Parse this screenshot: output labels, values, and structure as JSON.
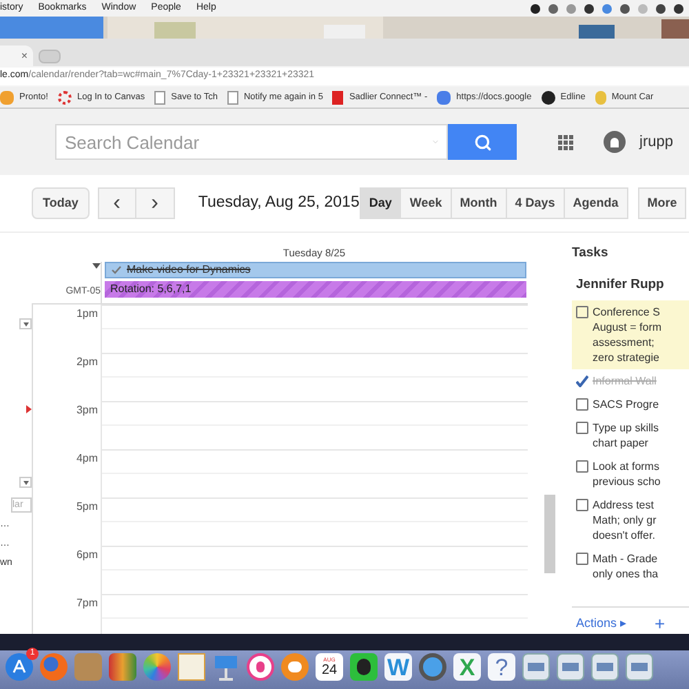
{
  "menu_bar": {
    "items": [
      "istory",
      "Bookmarks",
      "Window",
      "People",
      "Help"
    ]
  },
  "browser": {
    "tab_close": "×",
    "url_host": "le.com",
    "url_path": "/calendar/render?tab=wc#main_7%7Cday-1+23321+23321+23321",
    "bookmarks": [
      {
        "label": "Pronto!",
        "kind": "star"
      },
      {
        "label": "Log In to Canvas",
        "kind": "ring"
      },
      {
        "label": "Save to Tch",
        "kind": "page"
      },
      {
        "label": "Notify me again in 5",
        "kind": "page"
      },
      {
        "label": "Sadlier Connect™ -",
        "kind": "red"
      },
      {
        "label": "https://docs.google",
        "kind": "doc"
      },
      {
        "label": "Edline",
        "kind": "swirl"
      },
      {
        "label": "Mount Car",
        "kind": "gold"
      }
    ]
  },
  "header": {
    "search": {
      "placeholder": "Search Calendar"
    },
    "user": "jrupp"
  },
  "toolbar": {
    "today": "Today",
    "prev": "‹",
    "next": "›",
    "date": "Tuesday, Aug 25, 2015",
    "views": [
      {
        "label": "Day",
        "selected": true
      },
      {
        "label": "Week",
        "selected": false
      },
      {
        "label": "Month",
        "selected": false
      },
      {
        "label": "4 Days",
        "selected": false
      },
      {
        "label": "Agenda",
        "selected": false
      }
    ],
    "more": "More"
  },
  "sidebar": {
    "field_placeholder": "lar",
    "items": [
      "…",
      "…",
      "wn"
    ]
  },
  "day": {
    "heading": "Tuesday 8/25",
    "timezone": "GMT-05",
    "events": [
      {
        "title": "Make video for Dynamics",
        "kind": "task",
        "done": true
      },
      {
        "title": "Rotation: 5,6,7,1",
        "kind": "allday",
        "done": false
      }
    ],
    "hours": [
      "1pm",
      "2pm",
      "3pm",
      "4pm",
      "5pm",
      "6pm",
      "7pm"
    ]
  },
  "tasks": {
    "title": "Tasks",
    "list": "Jennifer Rupp",
    "items": [
      {
        "lines": [
          "Conference S",
          "August = form",
          "assessment;",
          "zero strategie"
        ],
        "checked": false,
        "selected": true
      },
      {
        "lines": [
          "Informal Wall"
        ],
        "checked": true,
        "selected": false
      },
      {
        "lines": [
          "SACS Progre"
        ],
        "checked": false,
        "selected": false
      },
      {
        "lines": [
          "Type up skills",
          "chart paper"
        ],
        "checked": false,
        "selected": false
      },
      {
        "lines": [
          "Look at forms",
          "previous scho"
        ],
        "checked": false,
        "selected": false
      },
      {
        "lines": [
          "Address test",
          "Math; only gr",
          "doesn't offer."
        ],
        "checked": false,
        "selected": false
      },
      {
        "lines": [
          "Math - Grade",
          "only ones tha"
        ],
        "checked": false,
        "selected": false
      }
    ],
    "actions": "Actions ▸",
    "add": "+"
  },
  "dock": [
    {
      "kind": "appstore",
      "badge": "1"
    },
    {
      "kind": "firefox"
    },
    {
      "kind": "contacts"
    },
    {
      "kind": "photobooth"
    },
    {
      "kind": "photos"
    },
    {
      "kind": "pages"
    },
    {
      "kind": "keynote"
    },
    {
      "kind": "itunes"
    },
    {
      "kind": "ibooks"
    },
    {
      "kind": "calendar",
      "month": "AUG",
      "date": "24"
    },
    {
      "kind": "evernote"
    },
    {
      "kind": "letter",
      "label": "W",
      "color": "#2a8fd8"
    },
    {
      "kind": "quicktime"
    },
    {
      "kind": "letter",
      "label": "X",
      "color": "#2fa84f"
    },
    {
      "kind": "help",
      "label": "?"
    },
    {
      "kind": "drive"
    },
    {
      "kind": "drive"
    },
    {
      "kind": "drive"
    },
    {
      "kind": "drive"
    }
  ]
}
